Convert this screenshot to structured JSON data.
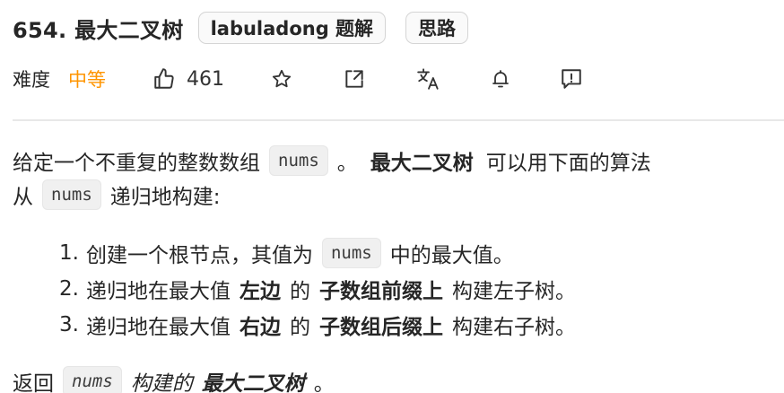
{
  "problem": {
    "title": "654. 最大二叉树",
    "tags": [
      "labuladong 题解",
      "思路"
    ]
  },
  "meta": {
    "difficulty_label": "难度",
    "difficulty": "中等",
    "difficulty_color": "#ff9500",
    "likes": "461",
    "icons": [
      "thumbs-up-icon",
      "star-icon",
      "share-icon",
      "translate-icon",
      "bell-icon",
      "feedback-icon"
    ]
  },
  "description": {
    "p1_a": "给定一个不重复的整数数组",
    "p1_code": "nums",
    "p1_b": "。",
    "p1_bold": "最大二叉树",
    "p1_c": "可以用下面的算法",
    "p2_a": "从",
    "p2_code": "nums",
    "p2_b": "递归地构建:",
    "steps": [
      {
        "num": "1.",
        "a": "创建一个根节点，其值为",
        "code": "nums",
        "b": "中的最大值。"
      },
      {
        "num": "2.",
        "a": "递归地在最大值",
        "bold1": "左边",
        "mid": "的",
        "bold2": "子数组前缀上",
        "b": "构建左子树。"
      },
      {
        "num": "3.",
        "a": "递归地在最大值",
        "bold1": "右边",
        "mid": "的",
        "bold2": "子数组后缀上",
        "b": "构建右子树。"
      }
    ],
    "final_a": "返回",
    "final_code": "nums",
    "final_italic": "构建的",
    "final_bold": "最大二叉树",
    "final_b": "。"
  }
}
